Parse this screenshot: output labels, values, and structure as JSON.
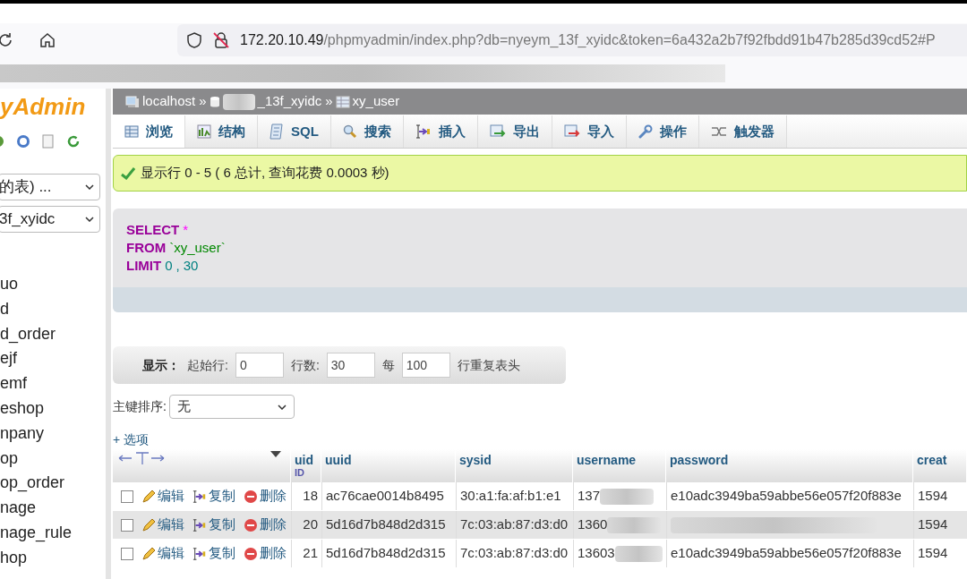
{
  "browser": {
    "url_host": "172.20.10.49",
    "url_path": "/phpmyadmin/index.php?db=nyeym_13f_xyidc&token=6a432a2b7f92fbdd91b47b285d39cd52#P"
  },
  "sidebar": {
    "logo": "yAdmin",
    "selects": [
      "的表) ...",
      "3f_xyidc"
    ],
    "tables": [
      "uo",
      "d",
      "d_order",
      "ejf",
      "emf",
      "eshop",
      "npany",
      "op",
      "op_order",
      "nage",
      "nage_rule",
      "hop"
    ]
  },
  "breadcrumb_separator": "»",
  "breadcrumb": [
    {
      "kind": "server",
      "label": "localhost",
      "blurred": false
    },
    {
      "kind": "database",
      "label": "_13f_xyidc",
      "blurred": true
    },
    {
      "kind": "table",
      "label": "xy_user",
      "blurred": false
    }
  ],
  "tabs": [
    {
      "kind": "browse",
      "label": "浏览",
      "selected": true
    },
    {
      "kind": "structure",
      "label": "结构",
      "selected": false
    },
    {
      "kind": "sql",
      "label": "SQL",
      "selected": false
    },
    {
      "kind": "search",
      "label": "搜索",
      "selected": false
    },
    {
      "kind": "insert",
      "label": "插入",
      "selected": false
    },
    {
      "kind": "export",
      "label": "导出",
      "selected": false
    },
    {
      "kind": "import",
      "label": "导入",
      "selected": false
    },
    {
      "kind": "operations",
      "label": "操作",
      "selected": false
    },
    {
      "kind": "triggers",
      "label": "触发器",
      "selected": false
    }
  ],
  "message": "显示行 0 - 5 ( 6 总计, 查询花费 0.0003 秒)",
  "sql": [
    [
      {
        "kind": "keyword",
        "text": "SELECT"
      },
      {
        "kind": "operator",
        "text": "*"
      }
    ],
    [
      {
        "kind": "keyword",
        "text": "FROM"
      },
      {
        "kind": "identifier",
        "text": "`xy_user`"
      }
    ],
    [
      {
        "kind": "keyword",
        "text": "LIMIT"
      },
      {
        "kind": "number",
        "text": "0"
      },
      {
        "kind": "punct",
        "text": ","
      },
      {
        "kind": "number",
        "text": "30"
      }
    ]
  ],
  "navigation": {
    "label": "显示：",
    "fields": [
      {
        "label": "起始行:",
        "value": "0"
      },
      {
        "label": "行数:",
        "value": "30"
      },
      {
        "label": "每",
        "value": "100"
      }
    ],
    "trailing": "行重复表头"
  },
  "sort": {
    "label": "主键排序:",
    "value": "无"
  },
  "options_link": "+ 选项",
  "table": {
    "columns": [
      {
        "label": "uid",
        "sublabel": "ID"
      },
      {
        "label": "uuid"
      },
      {
        "label": "sysid"
      },
      {
        "label": "username"
      },
      {
        "label": "password"
      },
      {
        "label": "creat"
      }
    ],
    "rows": [
      {
        "checked": false,
        "actions": [
          "编辑",
          "复制",
          "删除"
        ],
        "cells": [
          {
            "text": "18",
            "blurred": false
          },
          {
            "text": "ac76cae0014b8495",
            "blurred": false
          },
          {
            "text": "30:a1:fa:af:b1:e1",
            "blurred": false
          },
          {
            "text": "137",
            "blurred": true
          },
          {
            "text": "e10adc3949ba59abbe56e057f20f883e",
            "blurred": false
          },
          {
            "text": "1594",
            "blurred": false
          }
        ]
      },
      {
        "checked": false,
        "actions": [
          "编辑",
          "复制",
          "删除"
        ],
        "cells": [
          {
            "text": "20",
            "blurred": false
          },
          {
            "text": "5d16d7b848d2d315",
            "blurred": false
          },
          {
            "text": "7c:03:ab:87:d3:d0",
            "blurred": false
          },
          {
            "text": "1360",
            "blurred": true
          },
          {
            "blurred": true
          },
          {
            "text": "1594",
            "blurred": false
          }
        ]
      },
      {
        "checked": false,
        "actions": [
          "编辑",
          "复制",
          "删除"
        ],
        "cells": [
          {
            "text": "21",
            "blurred": false
          },
          {
            "text": "5d16d7b848d2d315",
            "blurred": false
          },
          {
            "text": "7c:03:ab:87:d3:d0",
            "blurred": false
          },
          {
            "text": "13603",
            "blurred": true
          },
          {
            "text": "e10adc3949ba59abbe56e057f20f883e",
            "blurred": false
          },
          {
            "text": "1594",
            "blurred": false
          }
        ]
      }
    ]
  }
}
